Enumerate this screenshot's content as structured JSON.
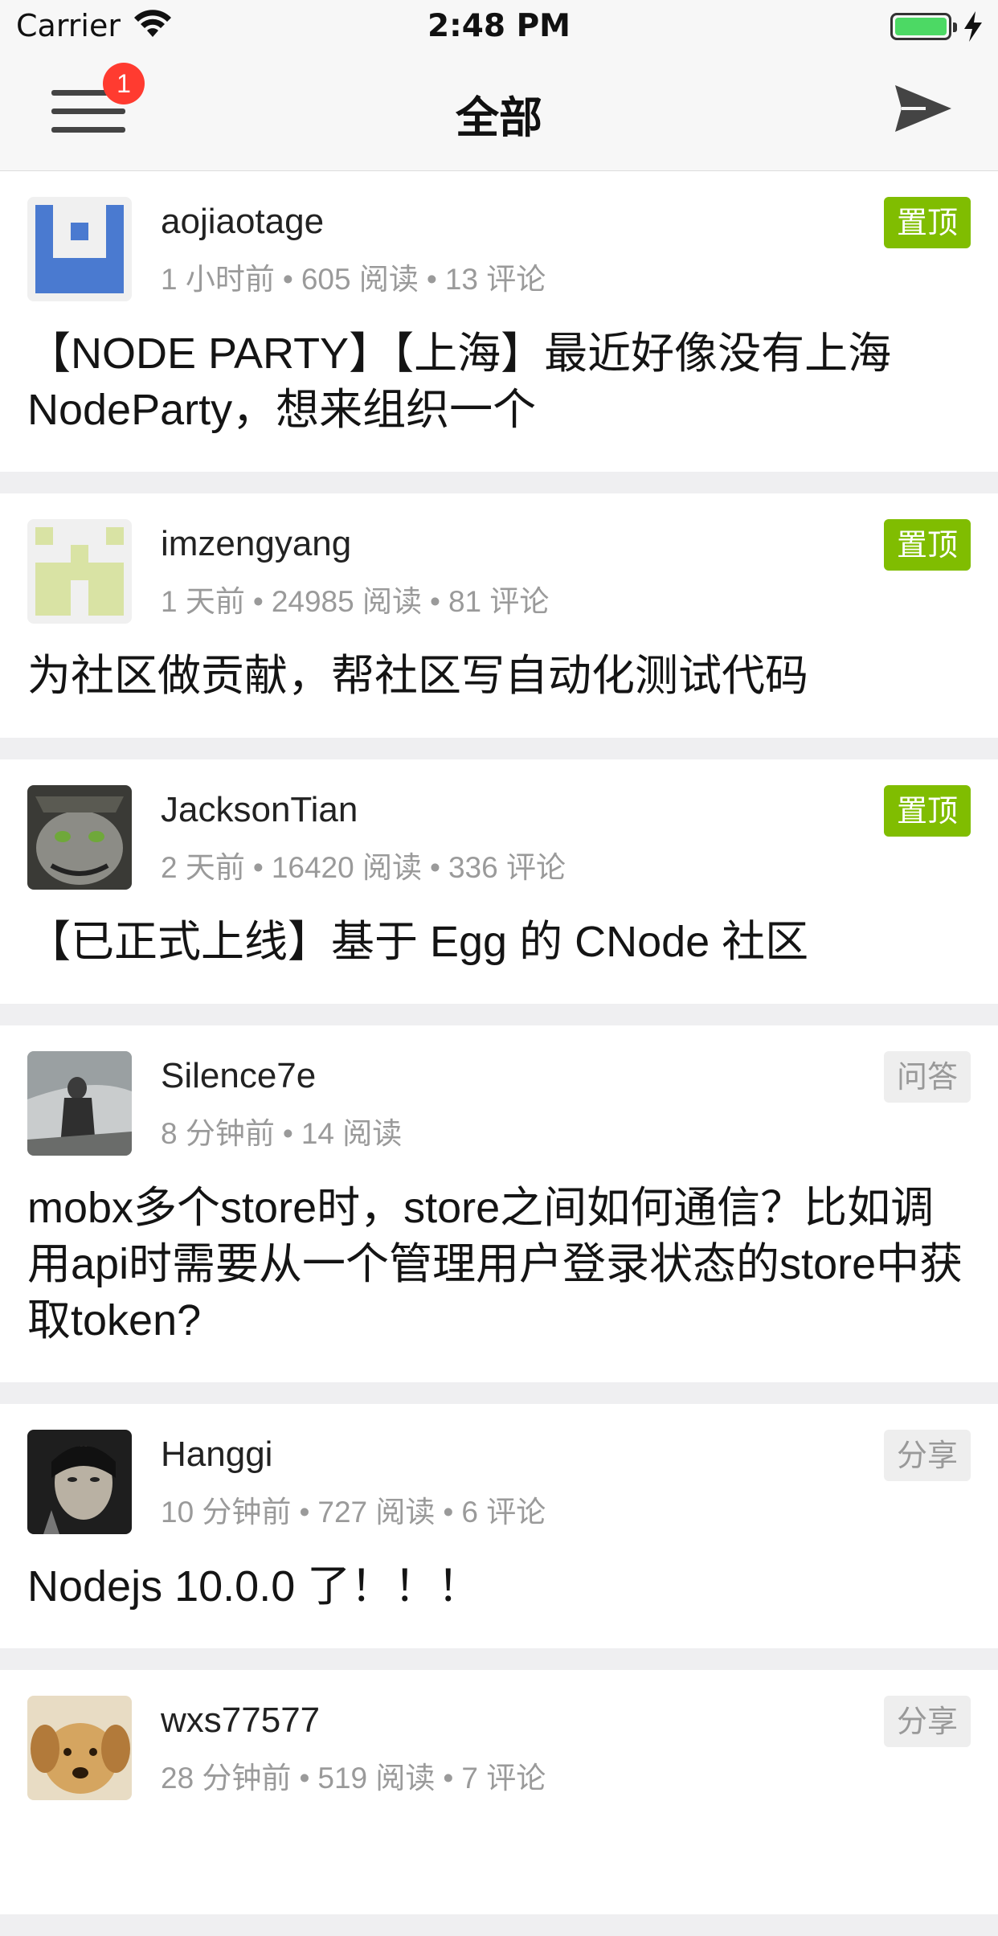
{
  "status_bar": {
    "carrier": "Carrier",
    "time": "2:48 PM"
  },
  "nav": {
    "title": "全部",
    "badge_count": "1"
  },
  "colors": {
    "pin_tag": "#80bd01",
    "badge": "#ff3b30",
    "battery": "#4cd964"
  },
  "topics": [
    {
      "author": "aojiaotage",
      "time": "1 小时前",
      "reads": "605 阅读",
      "comments": "13 评论",
      "tag": "置顶",
      "title": "【NODE PARTY】【上海】最近好像没有上海NodeParty，想来组织一个"
    },
    {
      "author": "imzengyang",
      "time": "1 天前",
      "reads": "24985 阅读",
      "comments": "81 评论",
      "tag": "置顶",
      "title": "为社区做贡献，帮社区写自动化测试代码"
    },
    {
      "author": "JacksonTian",
      "time": "2 天前",
      "reads": "16420 阅读",
      "comments": "336 评论",
      "tag": "置顶",
      "title": "【已正式上线】基于 Egg 的 CNode 社区"
    },
    {
      "author": "Silence7e",
      "time": "8 分钟前",
      "reads": "14 阅读",
      "comments": "",
      "tag": "问答",
      "title": "mobx多个store时，store之间如何通信？比如调用api时需要从一个管理用户登录状态的store中获取token?"
    },
    {
      "author": "Hanggi",
      "time": "10 分钟前",
      "reads": "727 阅读",
      "comments": "6 评论",
      "tag": "分享",
      "title": "Nodejs 10.0.0 了！！！"
    },
    {
      "author": "wxs77577",
      "time": "28 分钟前",
      "reads": "519 阅读",
      "comments": "7 评论",
      "tag": "分享",
      "title": ""
    }
  ]
}
